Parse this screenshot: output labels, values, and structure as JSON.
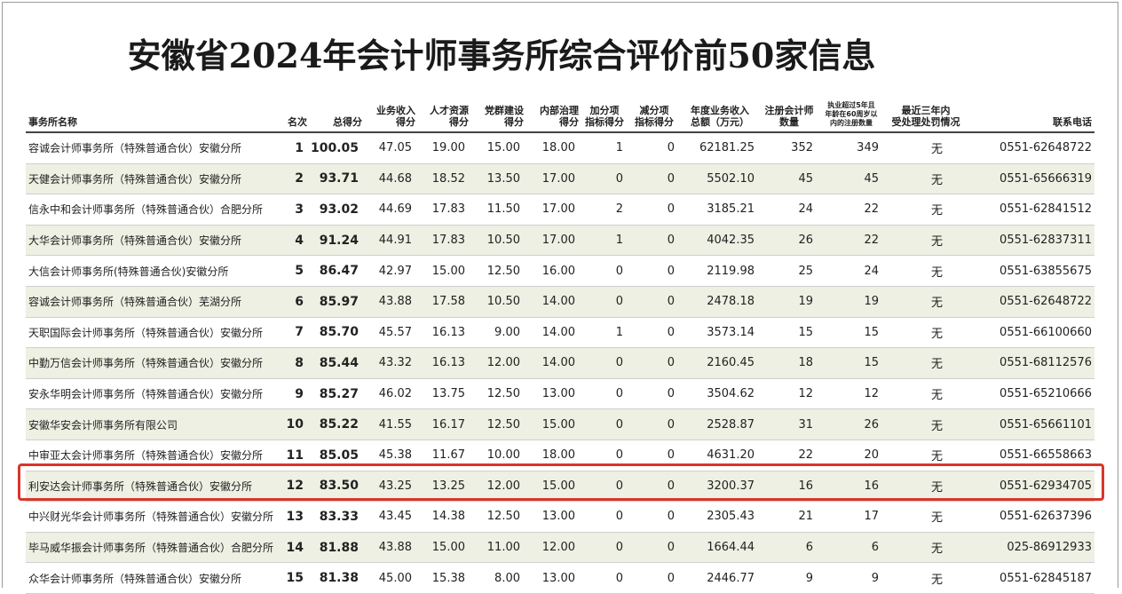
{
  "title": "安徽省2024年会计师事务所综合评价前50家信息",
  "headers": {
    "name": "事务所名称",
    "rank": "名次",
    "total": "总得分",
    "income_1": "业务收入",
    "income_2": "得分",
    "talent_1": "人才资源",
    "talent_2": "得分",
    "party_1": "党群建设",
    "party_2": "得分",
    "gov_1": "内部治理",
    "gov_2": "得分",
    "bonus_1": "加分项",
    "bonus_2": "指标得分",
    "minus_1": "减分项",
    "minus_2": "指标得分",
    "revenue_1": "年度业务收入",
    "revenue_2": "总额（万元）",
    "cpa_1": "注册会计师",
    "cpa_2": "数量",
    "senior_1": "执业超过5年且",
    "senior_2": "年龄在60周岁以",
    "senior_3": "内的注册数量",
    "penalty_1": "最近三年内",
    "penalty_2": "受处理处罚情况",
    "phone": "联系电话"
  },
  "rows": [
    {
      "name": "容诚会计师事务所（特殊普通合伙）安徽分所",
      "rank": "1",
      "total": "100.05",
      "income": "47.05",
      "talent": "19.00",
      "party": "15.00",
      "gov": "18.00",
      "bonus": "1",
      "minus": "0",
      "revenue": "62181.25",
      "cpa": "352",
      "senior": "349",
      "penalty": "无",
      "phone": "0551-62648722"
    },
    {
      "name": "天健会计师事务所（特殊普通合伙）安徽分所",
      "rank": "2",
      "total": "93.71",
      "income": "44.68",
      "talent": "18.52",
      "party": "13.50",
      "gov": "17.00",
      "bonus": "0",
      "minus": "0",
      "revenue": "5502.10",
      "cpa": "45",
      "senior": "45",
      "penalty": "无",
      "phone": "0551-65666319"
    },
    {
      "name": "信永中和会计师事务所（特殊普通合伙）合肥分所",
      "rank": "3",
      "total": "93.02",
      "income": "44.69",
      "talent": "17.83",
      "party": "11.50",
      "gov": "17.00",
      "bonus": "2",
      "minus": "0",
      "revenue": "3185.21",
      "cpa": "24",
      "senior": "22",
      "penalty": "无",
      "phone": "0551-62841512"
    },
    {
      "name": "大华会计师事务所（特殊普通合伙）安徽分所",
      "rank": "4",
      "total": "91.24",
      "income": "44.91",
      "talent": "17.83",
      "party": "10.50",
      "gov": "17.00",
      "bonus": "1",
      "minus": "0",
      "revenue": "4042.35",
      "cpa": "26",
      "senior": "22",
      "penalty": "无",
      "phone": "0551-62837311"
    },
    {
      "name": "大信会计师事务所(特殊普通合伙)安徽分所",
      "rank": "5",
      "total": "86.47",
      "income": "42.97",
      "talent": "15.00",
      "party": "12.50",
      "gov": "16.00",
      "bonus": "0",
      "minus": "0",
      "revenue": "2119.98",
      "cpa": "25",
      "senior": "24",
      "penalty": "无",
      "phone": "0551-63855675"
    },
    {
      "name": "容诚会计师事务所（特殊普通合伙）芜湖分所",
      "rank": "6",
      "total": "85.97",
      "income": "43.88",
      "talent": "17.58",
      "party": "10.50",
      "gov": "14.00",
      "bonus": "0",
      "minus": "0",
      "revenue": "2478.18",
      "cpa": "19",
      "senior": "19",
      "penalty": "无",
      "phone": "0551-62648722"
    },
    {
      "name": "天职国际会计师事务所（特殊普通合伙）安徽分所",
      "rank": "7",
      "total": "85.70",
      "income": "45.57",
      "talent": "16.13",
      "party": "9.00",
      "gov": "14.00",
      "bonus": "1",
      "minus": "0",
      "revenue": "3573.14",
      "cpa": "15",
      "senior": "15",
      "penalty": "无",
      "phone": "0551-66100660"
    },
    {
      "name": "中勤万信会计师事务所（特殊普通合伙）安徽分所",
      "rank": "8",
      "total": "85.44",
      "income": "43.32",
      "talent": "16.13",
      "party": "12.00",
      "gov": "14.00",
      "bonus": "0",
      "minus": "0",
      "revenue": "2160.45",
      "cpa": "18",
      "senior": "15",
      "penalty": "无",
      "phone": "0551-68112576"
    },
    {
      "name": "安永华明会计师事务所（特殊普通合伙）安徽分所",
      "rank": "9",
      "total": "85.27",
      "income": "46.02",
      "talent": "13.75",
      "party": "12.50",
      "gov": "13.00",
      "bonus": "0",
      "minus": "0",
      "revenue": "3504.62",
      "cpa": "12",
      "senior": "12",
      "penalty": "无",
      "phone": "0551-65210666"
    },
    {
      "name": "安徽华安会计师事务所有限公司",
      "rank": "10",
      "total": "85.22",
      "income": "41.55",
      "talent": "16.17",
      "party": "12.50",
      "gov": "15.00",
      "bonus": "0",
      "minus": "0",
      "revenue": "2528.87",
      "cpa": "31",
      "senior": "26",
      "penalty": "无",
      "phone": "0551-65661101"
    },
    {
      "name": "中审亚太会计师事务所（特殊普通合伙）安徽分所",
      "rank": "11",
      "total": "85.05",
      "income": "45.38",
      "talent": "11.67",
      "party": "10.00",
      "gov": "18.00",
      "bonus": "0",
      "minus": "0",
      "revenue": "4631.20",
      "cpa": "22",
      "senior": "20",
      "penalty": "无",
      "phone": "0551-66558663"
    },
    {
      "name": "利安达会计师事务所（特殊普通合伙）安徽分所",
      "rank": "12",
      "total": "83.50",
      "income": "43.25",
      "talent": "13.25",
      "party": "12.00",
      "gov": "15.00",
      "bonus": "0",
      "minus": "0",
      "revenue": "3200.37",
      "cpa": "16",
      "senior": "16",
      "penalty": "无",
      "phone": "0551-62934705"
    },
    {
      "name": "中兴财光华会计师事务所（特殊普通合伙）安徽分所",
      "rank": "13",
      "total": "83.33",
      "income": "43.45",
      "talent": "14.38",
      "party": "12.50",
      "gov": "13.00",
      "bonus": "0",
      "minus": "0",
      "revenue": "2305.43",
      "cpa": "21",
      "senior": "17",
      "penalty": "无",
      "phone": "0551-62637396"
    },
    {
      "name": "毕马威华振会计师事务所（特殊普通合伙）合肥分所",
      "rank": "14",
      "total": "81.88",
      "income": "43.88",
      "talent": "15.00",
      "party": "11.00",
      "gov": "12.00",
      "bonus": "0",
      "minus": "0",
      "revenue": "1664.44",
      "cpa": "6",
      "senior": "6",
      "penalty": "无",
      "phone": "025-86912933"
    },
    {
      "name": "众华会计师事务所（特殊普通合伙）安徽分所",
      "rank": "15",
      "total": "81.38",
      "income": "45.00",
      "talent": "15.38",
      "party": "8.00",
      "gov": "13.00",
      "bonus": "0",
      "minus": "0",
      "revenue": "2446.77",
      "cpa": "9",
      "senior": "9",
      "penalty": "无",
      "phone": "0551-62845187"
    }
  ],
  "highlight_color": "#d9362b",
  "stripe_color": "#edf0e2"
}
